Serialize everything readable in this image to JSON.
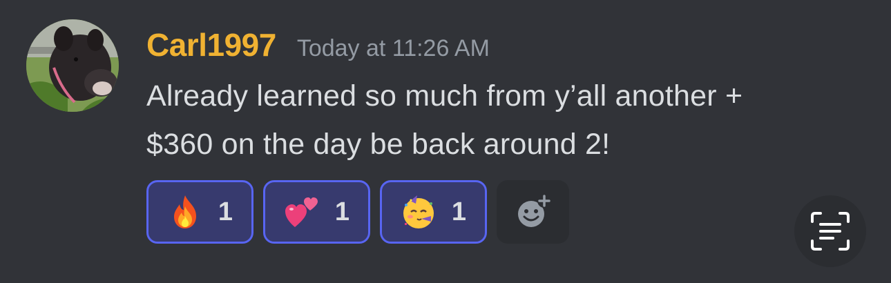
{
  "message": {
    "author": "Carl1997",
    "timestamp": "Today at 11:26 AM",
    "content_lines": [
      "Already learned so much from y’all another +",
      "$360 on the day be back around 2!"
    ]
  },
  "reactions": [
    {
      "emoji": "fire-emoji",
      "count": "1"
    },
    {
      "emoji": "two-hearts-emoji",
      "count": "1"
    },
    {
      "emoji": "partying-face-emoji",
      "count": "1"
    }
  ],
  "add_reaction_icon": "add-reaction-icon",
  "scan_icon": "text-scan-icon",
  "colors": {
    "background": "#313338",
    "username": "#f0b232",
    "timestamp": "#949ba4",
    "text": "#dbdee1",
    "reaction_border": "#5865f2",
    "reaction_bg": "#373a6e"
  }
}
